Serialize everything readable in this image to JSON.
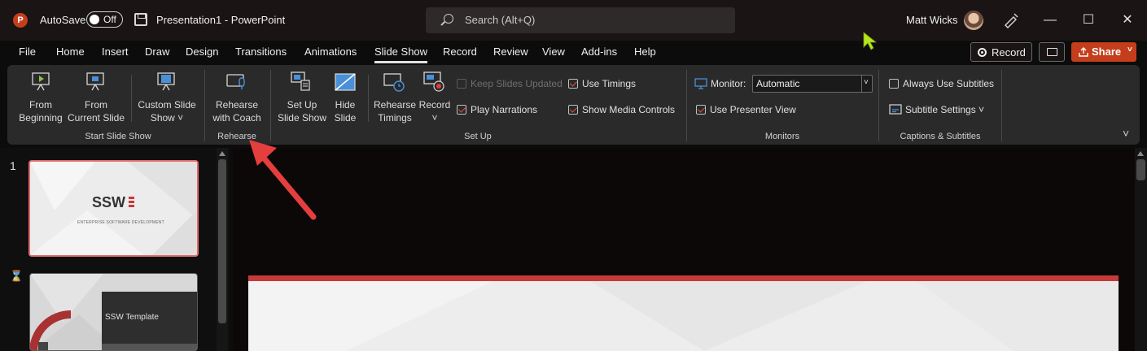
{
  "titlebar": {
    "app_icon_letter": "P",
    "autosave_label": "AutoSave",
    "autosave_state": "Off",
    "document_title": "Presentation1  -  PowerPoint",
    "search_placeholder": "Search (Alt+Q)",
    "user_name": "Matt Wicks",
    "minimize_glyph": "—",
    "maximize_glyph": "☐",
    "close_glyph": "✕"
  },
  "menu": {
    "items": [
      "File",
      "Home",
      "Insert",
      "Draw",
      "Design",
      "Transitions",
      "Animations",
      "Slide Show",
      "Record",
      "Review",
      "View",
      "Add-ins",
      "Help"
    ],
    "active": "Slide Show",
    "record_button": "Record",
    "share_button": "Share"
  },
  "ribbon": {
    "groups": {
      "start": "Start Slide Show",
      "rehearse": "Rehearse",
      "setup": "Set Up",
      "monitors": "Monitors",
      "captions": "Captions & Subtitles"
    },
    "buttons": {
      "from_beginning": [
        "From",
        "Beginning"
      ],
      "from_current": [
        "From",
        "Current Slide"
      ],
      "custom_show": [
        "Custom Slide",
        "Show ˅"
      ],
      "rehearse_coach": [
        "Rehearse",
        "with Coach"
      ],
      "setup_show": [
        "Set Up",
        "Slide Show"
      ],
      "hide_slide": [
        "Hide",
        "Slide"
      ],
      "rehearse_timings": [
        "Rehearse",
        "Timings"
      ],
      "record": [
        "Record",
        "˅"
      ]
    },
    "options": {
      "keep_updated": "Keep Slides Updated",
      "play_narrations": "Play Narrations",
      "use_timings": "Use Timings",
      "media_controls": "Show Media Controls",
      "monitor_label": "Monitor:",
      "monitor_value": "Automatic",
      "presenter_view": "Use Presenter View",
      "always_subtitles": "Always Use Subtitles",
      "subtitle_settings": "Subtitle Settings ˅"
    },
    "checks": {
      "keep_updated": false,
      "play_narrations": true,
      "use_timings": true,
      "media_controls": true,
      "presenter_view": true,
      "always_subtitles": false
    }
  },
  "slides": {
    "slide1_number": "1",
    "slide1_logo": "SSW",
    "slide1_tagline": "ENTERPRISE SOFTWARE DEVELOPMENT",
    "slide2_marker": "⌛",
    "slide2_title": "SSW Template"
  },
  "colors": {
    "accent": "#c43e1c",
    "annotation_arrow": "#e53e3e",
    "cursor": "#b5e61d"
  }
}
